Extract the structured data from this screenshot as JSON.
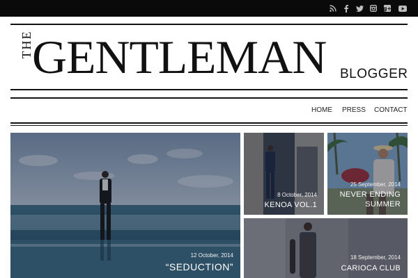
{
  "header": {
    "social_icons": [
      "rss-icon",
      "facebook-icon",
      "twitter-icon",
      "instagram-icon",
      "google-plus-icon",
      "youtube-icon"
    ],
    "logo": {
      "the": "THE",
      "main": "GENTLEMAN",
      "sub": "BLOGGER"
    }
  },
  "nav": {
    "items": [
      {
        "label": "HOME"
      },
      {
        "label": "PRESS"
      },
      {
        "label": "CONTACT"
      }
    ]
  },
  "posts": [
    {
      "date": "12 October, 2014",
      "title": "“SEDUCTION”"
    },
    {
      "date": "8 October, 2014",
      "title": "KENOA VOL.1"
    },
    {
      "date": "25 September, 2014",
      "title_line1": "NEVER ENDING",
      "title_line2": "SUMMER"
    },
    {
      "date": "18 September, 2014",
      "title": "CARIOCA CLUB"
    }
  ],
  "colors": {
    "topbar": "#0a0a0a",
    "icon": "#bdbdbd",
    "text": "#111111"
  }
}
